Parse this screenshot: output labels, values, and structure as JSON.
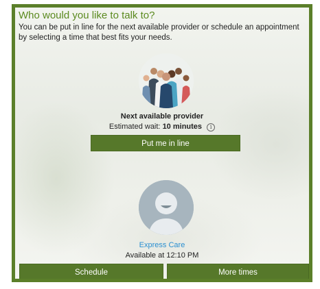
{
  "header": {
    "title": "Who would you like to talk to?",
    "intro": "You can be put in line for the next available provider or schedule an appointment by selecting a time that best fits your needs."
  },
  "next_provider": {
    "label": "Next available provider",
    "wait_prefix": "Estimated wait:",
    "wait_value": "10 minutes",
    "info_icon": "info-icon",
    "button_label": "Put me in line"
  },
  "express_care": {
    "name": "Express Care",
    "availability": "Available at 12:10 PM",
    "schedule_label": "Schedule",
    "more_times_label": "More times"
  },
  "colors": {
    "accent": "#5b7f2a",
    "title": "#5b8a1f",
    "link": "#2a8fd1"
  }
}
